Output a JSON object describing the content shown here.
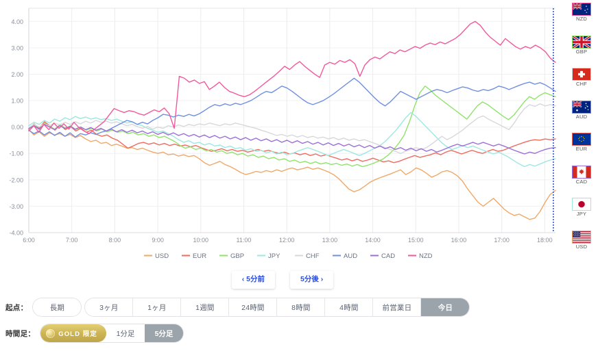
{
  "chart_data": {
    "type": "line",
    "title": "",
    "xlabel": "",
    "ylabel": "",
    "ylim": [
      -4.0,
      4.5
    ],
    "yticks": [
      4.0,
      3.0,
      2.0,
      1.0,
      0.0,
      -1.0,
      -2.0,
      -3.0,
      -4.0
    ],
    "ytick_labels": [
      "4.00",
      "3.00",
      "2.00",
      "1.00",
      "0.00",
      "-1.00",
      "-2.00",
      "-3.00",
      "-4.00"
    ],
    "x": [
      "6:00",
      "7:00",
      "8:00",
      "9:00",
      "10:00",
      "11:00",
      "12:00",
      "13:00",
      "14:00",
      "15:00",
      "16:00",
      "17:00",
      "18:00"
    ],
    "xtick_labels": [
      "6:00",
      "7:00",
      "8:00",
      "9:00",
      "10:00",
      "11:00",
      "12:00",
      "13:00",
      "14:00",
      "15:00",
      "16:00",
      "17:00",
      "18:00"
    ],
    "xlim": [
      6.0,
      18.25
    ],
    "grid": true,
    "legend_position": "bottom",
    "current_time_marker": 18.2,
    "series": [
      {
        "name": "USD",
        "color": "#f0a868",
        "values": [
          -0.1,
          -0.3,
          -0.18,
          -0.35,
          -0.22,
          -0.3,
          -0.25,
          -0.35,
          -0.28,
          -0.4,
          -0.32,
          -0.45,
          -0.55,
          -0.5,
          -0.62,
          -0.58,
          -0.7,
          -0.65,
          -0.72,
          -0.8,
          -0.78,
          -0.85,
          -0.8,
          -0.88,
          -0.95,
          -1.0,
          -0.95,
          -1.05,
          -1.02,
          -1.1,
          -1.05,
          -1.12,
          -1.08,
          -1.2,
          -1.35,
          -1.45,
          -1.38,
          -1.3,
          -1.42,
          -1.5,
          -1.6,
          -1.72,
          -1.8,
          -1.75,
          -1.68,
          -1.72,
          -1.65,
          -1.7,
          -1.62,
          -1.68,
          -1.6,
          -1.55,
          -1.62,
          -1.58,
          -1.52,
          -1.6,
          -1.55,
          -1.62,
          -1.7,
          -1.8,
          -1.95,
          -2.15,
          -2.35,
          -2.45,
          -2.38,
          -2.25,
          -2.1,
          -2.0,
          -1.92,
          -1.85,
          -1.78,
          -1.7,
          -1.62,
          -1.8,
          -1.7,
          -1.55,
          -1.62,
          -1.75,
          -1.9,
          -1.82,
          -1.7,
          -1.65,
          -1.72,
          -1.85,
          -2.05,
          -2.35,
          -2.6,
          -2.85,
          -3.0,
          -2.85,
          -2.7,
          -2.9,
          -3.1,
          -3.25,
          -3.35,
          -3.3,
          -3.4,
          -3.5,
          -3.45,
          -3.2,
          -2.85,
          -2.55,
          -2.4
        ]
      },
      {
        "name": "EUR",
        "color": "#ef6b5e",
        "values": [
          -0.08,
          0.12,
          -0.05,
          0.2,
          0.05,
          -0.12,
          0.08,
          -0.1,
          0.02,
          -0.15,
          -0.05,
          -0.2,
          -0.12,
          -0.28,
          -0.35,
          -0.3,
          -0.42,
          -0.5,
          -0.65,
          -0.8,
          -0.72,
          -0.62,
          -0.58,
          -0.65,
          -0.6,
          -0.68,
          -0.62,
          -0.7,
          -0.65,
          -0.72,
          -0.68,
          -0.75,
          -0.7,
          -0.78,
          -0.85,
          -0.92,
          -0.88,
          -0.82,
          -0.9,
          -0.85,
          -0.92,
          -0.88,
          -0.95,
          -0.9,
          -0.85,
          -0.92,
          -0.88,
          -0.95,
          -1.0,
          -0.95,
          -1.02,
          -0.98,
          -1.05,
          -1.0,
          -1.08,
          -1.02,
          -1.1,
          -1.05,
          -1.12,
          -1.18,
          -1.25,
          -1.2,
          -1.28,
          -1.22,
          -1.3,
          -1.25,
          -1.18,
          -1.25,
          -1.32,
          -1.28,
          -1.35,
          -1.3,
          -1.22,
          -1.15,
          -1.08,
          -1.15,
          -1.1,
          -1.05,
          -0.98,
          -1.05,
          -0.95,
          -0.88,
          -0.95,
          -1.02,
          -0.95,
          -0.88,
          -0.95,
          -1.0,
          -0.92,
          -0.85,
          -0.92,
          -0.88,
          -0.8,
          -0.72,
          -0.65,
          -0.58,
          -0.52,
          -0.48,
          -0.5,
          -0.45,
          -0.48,
          -0.45
        ]
      },
      {
        "name": "GBP",
        "color": "#8fe36b",
        "values": [
          -0.05,
          0.08,
          -0.1,
          0.15,
          0.02,
          -0.08,
          0.1,
          -0.05,
          0.05,
          -0.1,
          0.0,
          -0.12,
          -0.05,
          -0.15,
          -0.08,
          -0.18,
          -0.12,
          -0.2,
          -0.15,
          -0.25,
          -0.2,
          -0.3,
          -0.25,
          -0.35,
          -0.3,
          -0.4,
          -0.35,
          -0.45,
          -0.55,
          -0.7,
          -0.8,
          -0.75,
          -0.85,
          -0.8,
          -0.9,
          -0.85,
          -0.95,
          -0.9,
          -1.0,
          -0.95,
          -1.05,
          -1.0,
          -1.1,
          -1.05,
          -1.15,
          -1.1,
          -1.2,
          -1.15,
          -1.25,
          -1.2,
          -1.3,
          -1.25,
          -1.35,
          -1.3,
          -1.38,
          -1.32,
          -1.4,
          -1.35,
          -1.42,
          -1.38,
          -1.45,
          -1.4,
          -1.48,
          -1.42,
          -1.5,
          -1.45,
          -1.38,
          -1.3,
          -1.2,
          -1.05,
          -0.85,
          -0.6,
          -0.3,
          0.2,
          0.8,
          1.3,
          1.55,
          1.4,
          1.2,
          1.05,
          0.9,
          0.75,
          0.6,
          0.45,
          0.3,
          0.55,
          0.8,
          0.95,
          0.85,
          0.7,
          0.55,
          0.4,
          0.28,
          0.45,
          0.7,
          0.95,
          1.15,
          1.05,
          1.2,
          1.3,
          1.22,
          1.15
        ]
      },
      {
        "name": "JPY",
        "color": "#9ce8e0",
        "values": [
          0.05,
          0.18,
          0.1,
          0.25,
          0.15,
          0.3,
          0.22,
          0.35,
          0.28,
          0.4,
          0.32,
          0.38,
          0.3,
          0.35,
          0.28,
          0.32,
          0.25,
          0.3,
          0.22,
          0.15,
          0.2,
          0.1,
          0.05,
          -0.05,
          -0.12,
          -0.2,
          -0.15,
          -0.25,
          -0.35,
          -0.48,
          -0.58,
          -0.52,
          -0.62,
          -0.58,
          -0.68,
          -0.62,
          -0.72,
          -0.68,
          -0.78,
          -0.72,
          -0.82,
          -0.78,
          -0.88,
          -0.82,
          -0.92,
          -0.88,
          -0.98,
          -0.92,
          -1.02,
          -0.95,
          -1.05,
          -1.0,
          -0.92,
          -0.85,
          -0.78,
          -0.85,
          -0.92,
          -1.0,
          -1.08,
          -1.0,
          -0.92,
          -0.85,
          -0.92,
          -1.0,
          -1.08,
          -1.0,
          -0.9,
          -0.8,
          -0.7,
          -0.55,
          -0.35,
          -0.15,
          0.1,
          0.35,
          0.55,
          0.4,
          0.2,
          0.0,
          -0.2,
          -0.4,
          -0.6,
          -0.75,
          -0.85,
          -0.78,
          -0.7,
          -0.78,
          -0.72,
          -0.8,
          -0.88,
          -0.95,
          -1.02,
          -0.95,
          -1.05,
          -1.15,
          -1.28,
          -1.4,
          -1.5,
          -1.42,
          -1.48,
          -1.4,
          -1.32,
          -1.25,
          -1.2
        ]
      },
      {
        "name": "CHF",
        "color": "#d8d8dc",
        "values": [
          -0.02,
          0.1,
          0.0,
          0.12,
          0.05,
          0.15,
          0.08,
          0.18,
          0.1,
          0.2,
          0.12,
          0.22,
          0.15,
          0.25,
          0.18,
          0.22,
          0.15,
          0.2,
          0.12,
          0.05,
          0.1,
          0.02,
          -0.05,
          0.02,
          -0.08,
          0.0,
          -0.05,
          0.05,
          0.0,
          0.08,
          0.02,
          0.1,
          0.05,
          0.12,
          0.08,
          0.15,
          0.1,
          0.05,
          0.12,
          0.08,
          0.15,
          0.1,
          0.05,
          0.0,
          -0.05,
          -0.12,
          -0.18,
          -0.25,
          -0.32,
          -0.28,
          -0.35,
          -0.3,
          -0.38,
          -0.32,
          -0.4,
          -0.35,
          -0.42,
          -0.38,
          -0.45,
          -0.4,
          -0.48,
          -0.42,
          -0.5,
          -0.45,
          -0.52,
          -0.48,
          -0.55,
          -0.62,
          -0.7,
          -0.78,
          -0.85,
          -0.92,
          -1.0,
          -0.92,
          -0.85,
          -0.78,
          -0.85,
          -0.78,
          -0.65,
          -0.5,
          -0.35,
          -0.48,
          -0.38,
          -0.25,
          -0.12,
          0.05,
          0.2,
          0.35,
          0.42,
          0.3,
          0.2,
          0.1,
          0.0,
          -0.1,
          0.15,
          0.45,
          0.7,
          0.85,
          0.78,
          0.88,
          0.8,
          0.85,
          0.8
        ]
      },
      {
        "name": "AUD",
        "color": "#6f8fe0",
        "values": [
          -0.12,
          -0.25,
          -0.15,
          -0.3,
          -0.18,
          -0.32,
          -0.2,
          -0.35,
          -0.22,
          -0.38,
          -0.25,
          -0.3,
          -0.22,
          -0.28,
          -0.2,
          -0.15,
          -0.05,
          0.05,
          0.15,
          0.25,
          0.2,
          0.1,
          0.18,
          0.12,
          0.25,
          0.35,
          0.48,
          0.45,
          0.38,
          0.45,
          0.4,
          0.48,
          0.42,
          0.5,
          0.62,
          0.75,
          0.85,
          0.8,
          0.88,
          0.82,
          0.9,
          0.85,
          0.92,
          1.0,
          1.12,
          1.25,
          1.35,
          1.3,
          1.42,
          1.55,
          1.48,
          1.35,
          1.2,
          1.05,
          0.92,
          0.85,
          0.92,
          1.0,
          1.12,
          1.25,
          1.4,
          1.55,
          1.7,
          1.85,
          1.7,
          1.5,
          1.3,
          1.1,
          0.92,
          0.8,
          0.95,
          1.15,
          1.35,
          1.25,
          1.15,
          1.05,
          1.15,
          1.25,
          1.35,
          1.42,
          1.38,
          1.3,
          1.38,
          1.45,
          1.52,
          1.48,
          1.4,
          1.35,
          1.42,
          1.38,
          1.45,
          1.55,
          1.5,
          1.42,
          1.5,
          1.58,
          1.65,
          1.7,
          1.62,
          1.68,
          1.6,
          1.48,
          1.35
        ]
      },
      {
        "name": "CAD",
        "color": "#9b6fd8",
        "values": [
          -0.06,
          0.05,
          -0.08,
          0.1,
          0.0,
          -0.1,
          0.05,
          -0.05,
          0.02,
          -0.08,
          0.0,
          -0.1,
          -0.02,
          -0.12,
          -0.05,
          -0.15,
          -0.08,
          -0.18,
          -0.1,
          -0.2,
          -0.12,
          -0.22,
          -0.15,
          -0.25,
          -0.18,
          -0.28,
          -0.2,
          -0.3,
          -0.22,
          -0.32,
          -0.25,
          -0.35,
          -0.28,
          -0.38,
          -0.3,
          -0.4,
          -0.32,
          -0.42,
          -0.35,
          -0.45,
          -0.38,
          -0.48,
          -0.4,
          -0.5,
          -0.42,
          -0.52,
          -0.45,
          -0.55,
          -0.48,
          -0.58,
          -0.5,
          -0.6,
          -0.52,
          -0.62,
          -0.55,
          -0.65,
          -0.58,
          -0.68,
          -0.6,
          -0.7,
          -0.62,
          -0.72,
          -0.65,
          -0.75,
          -0.68,
          -0.78,
          -0.7,
          -0.8,
          -0.72,
          -0.82,
          -0.75,
          -0.85,
          -0.78,
          -0.88,
          -0.8,
          -0.9,
          -0.82,
          -0.92,
          -0.85,
          -0.95,
          -0.88,
          -0.8,
          -0.72,
          -0.65,
          -0.72,
          -0.65,
          -0.58,
          -0.65,
          -0.58,
          -0.65,
          -0.72,
          -0.65,
          -0.72,
          -0.8,
          -0.88,
          -0.95,
          -1.02,
          -0.95,
          -1.0,
          -0.92,
          -0.85,
          -0.8,
          -0.78
        ]
      },
      {
        "name": "NZD",
        "color": "#f2589b",
        "values": [
          -0.15,
          0.05,
          -0.2,
          0.1,
          -0.1,
          0.15,
          -0.05,
          0.12,
          -0.08,
          0.18,
          -0.02,
          -0.15,
          -0.25,
          -0.1,
          0.05,
          0.2,
          0.45,
          0.7,
          0.62,
          0.55,
          0.62,
          0.58,
          0.5,
          0.45,
          0.55,
          0.65,
          0.58,
          0.72,
          0.5,
          -0.05,
          1.92,
          1.85,
          1.7,
          1.78,
          1.65,
          1.72,
          1.42,
          1.55,
          1.7,
          1.5,
          1.35,
          1.28,
          1.2,
          1.15,
          1.22,
          1.35,
          1.5,
          1.65,
          1.8,
          1.95,
          2.12,
          2.3,
          2.18,
          2.35,
          2.48,
          2.3,
          2.15,
          2.0,
          1.88,
          2.35,
          2.45,
          2.38,
          2.52,
          2.45,
          2.55,
          2.4,
          1.92,
          2.35,
          2.55,
          2.65,
          2.58,
          2.72,
          2.85,
          2.78,
          2.92,
          2.85,
          2.95,
          3.05,
          2.98,
          3.1,
          3.18,
          3.12,
          3.22,
          3.15,
          3.25,
          3.35,
          3.5,
          3.7,
          3.9,
          4.0,
          3.85,
          3.6,
          3.4,
          3.25,
          3.1,
          3.35,
          3.2,
          3.05,
          2.95,
          3.05,
          2.98,
          3.1,
          3.0,
          2.85,
          2.6,
          2.45
        ]
      }
    ]
  },
  "flag_rail": [
    {
      "code": "NZD",
      "border_color": "#f2589b"
    },
    {
      "code": "GBP",
      "border_color": "#8fe36b"
    },
    {
      "code": "CHF",
      "border_color": "#d8d8dc"
    },
    {
      "code": "AUD",
      "border_color": "#6f8fe0"
    },
    {
      "code": "EUR",
      "border_color": "#ef6b5e"
    },
    {
      "code": "CAD",
      "border_color": "#9b6fd8"
    },
    {
      "code": "JPY",
      "border_color": "#9ce8e0"
    },
    {
      "code": "USD",
      "border_color": "#f0a868"
    }
  ],
  "nav": {
    "prev_label": "‹ 5分前",
    "next_label": "5分後 ›"
  },
  "origin_row": {
    "label": "起点：",
    "options": [
      "長期",
      "3ヶ月",
      "1ヶ月",
      "1週間",
      "24時間",
      "8時間",
      "4時間",
      "前営業日",
      "今日"
    ],
    "selected": "今日"
  },
  "timeframe_row": {
    "label": "時間足：",
    "gold_badge": "GOLD 限定",
    "options": [
      "1分足",
      "5分足"
    ],
    "selected": "5分足"
  }
}
